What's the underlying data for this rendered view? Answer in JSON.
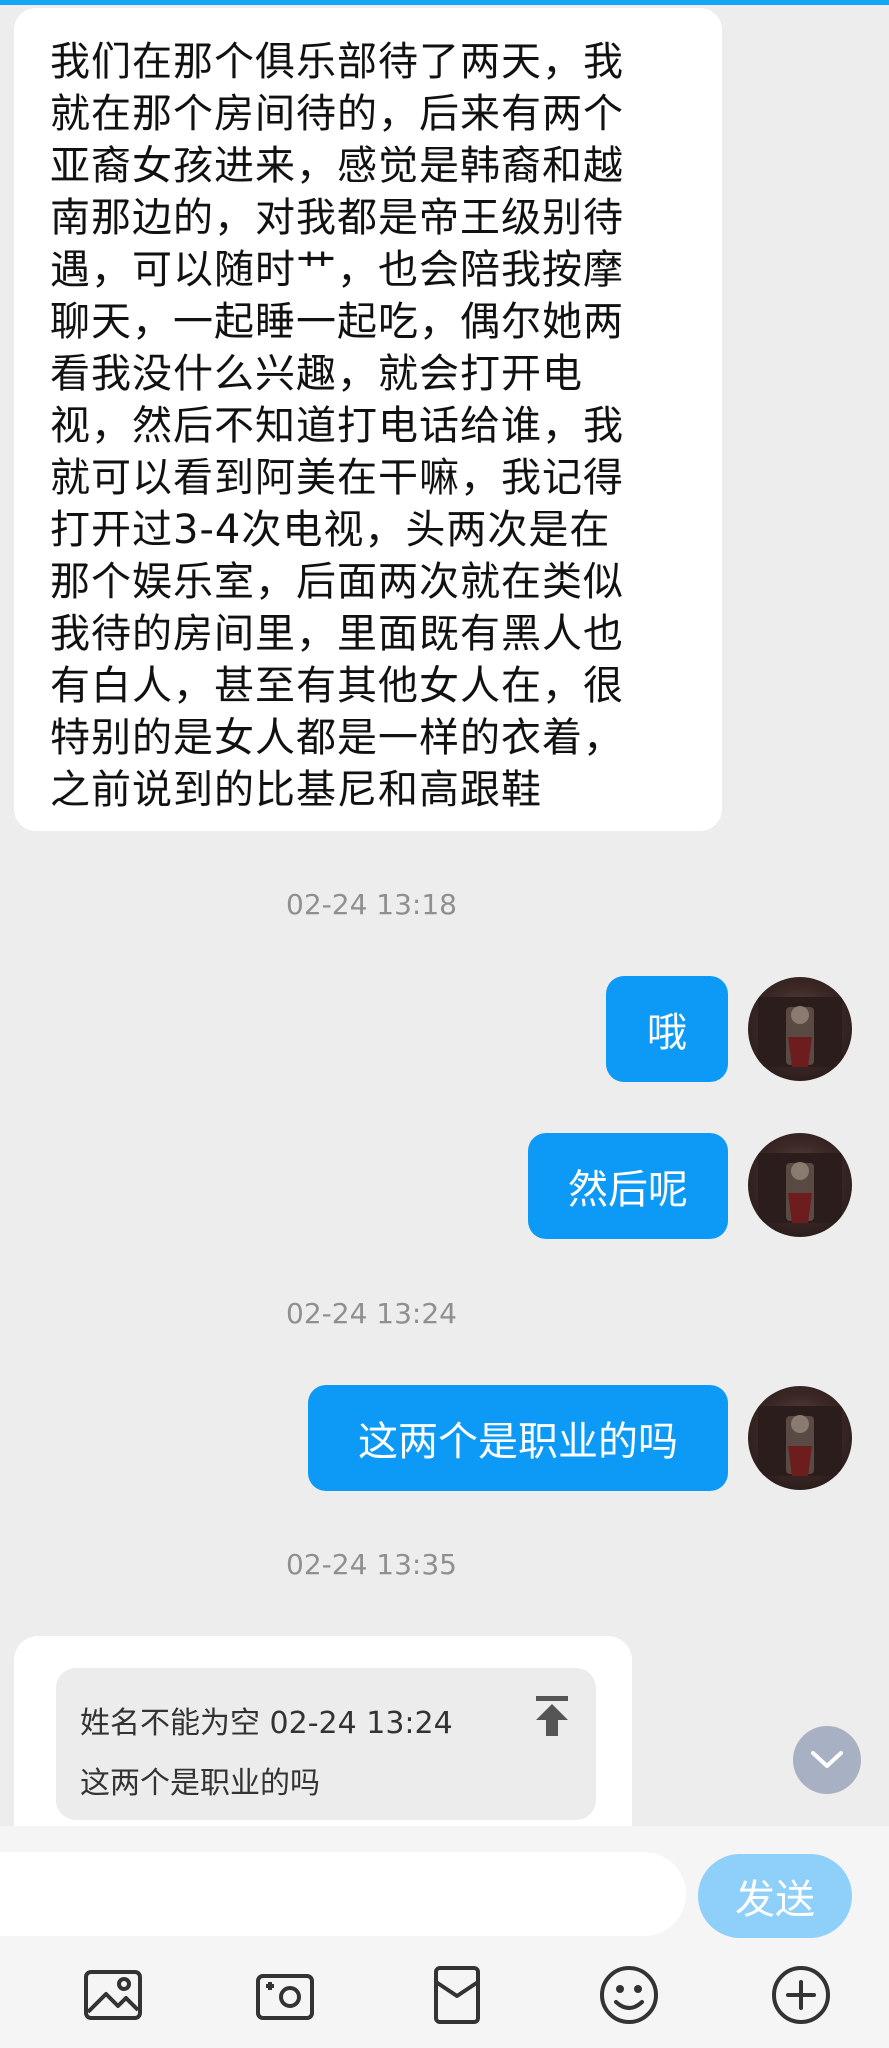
{
  "messages": {
    "incoming_1": "我们在那个俱乐部待了两天，我\n就在那个房间待的，后来有两个\n亚裔女孩进来，感觉是韩裔和越\n南那边的，对我都是帝王级别待\n遇，可以随时艹，也会陪我按摩\n聊天，一起睡一起吃，偶尔她两\n看我没什么兴趣，就会打开电\n视，然后不知道打电话给谁，我\n就可以看到阿美在干嘛，我记得\n打开过3-4次电视，头两次是在\n那个娱乐室，后面两次就在类似\n我待的房间里，里面既有黑人也\n有白人，甚至有其他女人在，很\n特别的是女人都是一样的衣着，\n之前说到的比基尼和高跟鞋",
    "ts_1": "02-24 13:18",
    "out_1": "哦",
    "out_2": "然后呢",
    "ts_2": "02-24 13:24",
    "out_3": "这两个是职业的吗",
    "ts_3": "02-24 13:35",
    "quote_meta": "姓名不能为空 02-24 13:24",
    "quote_text": "这两个是职业的吗"
  },
  "input": {
    "send_label": "发送"
  },
  "icons": {
    "pin": "pin-to-top-icon",
    "scroll": "chevron-down-icon",
    "toolbar": [
      "image-icon",
      "camera-icon",
      "red-packet-icon",
      "emoji-icon",
      "plus-icon"
    ]
  },
  "colors": {
    "accent": "#0d9af7",
    "send_disabled": "#8fd0fa",
    "background": "#ededed"
  }
}
